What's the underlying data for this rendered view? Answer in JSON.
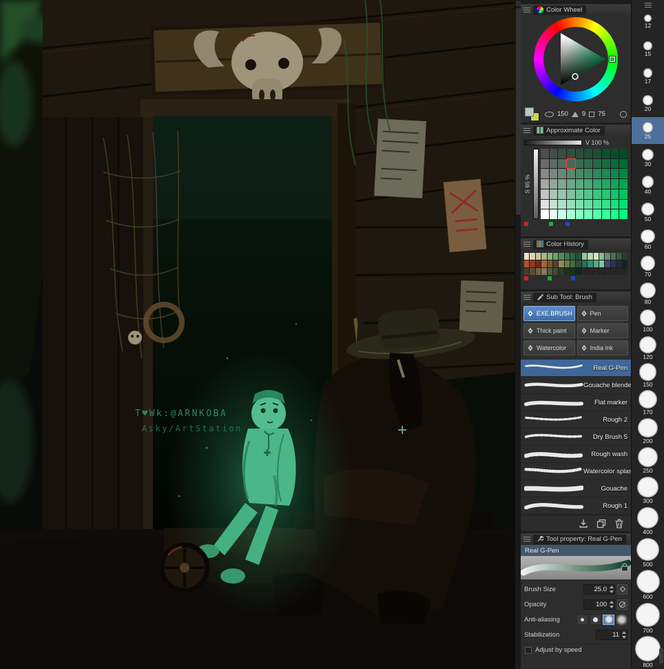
{
  "canvas": {
    "watermark_line1": "T♥Wk:@ARNKOBA",
    "watermark_line2": "Asky/ArtStation"
  },
  "rgb_markers": [
    "#cc2222",
    "#22aa33",
    "#2244cc"
  ],
  "color_wheel": {
    "title": "Color Wheel",
    "hue": "150",
    "sat": "9",
    "val": "75"
  },
  "approximate_color": {
    "title": "Approximate Color",
    "value_label": "V 100 %",
    "sat_label": "S 65 %",
    "grid": {
      "cols": 10,
      "rows": 7,
      "hue": 150,
      "selected_col": 3,
      "selected_row": 1
    }
  },
  "color_history": {
    "title": "Color History",
    "cols": 18,
    "swatches": [
      "#e7e2c6",
      "#d9d3b2",
      "#c7c4a0",
      "#a9b388",
      "#8ab078",
      "#6aa26a",
      "#4f8f5f",
      "#3b7a52",
      "#2d6547",
      "#24543c",
      "#9cc49a",
      "#b7d8ab",
      "#d2e8c0",
      "#8fb691",
      "#63926f",
      "#4a7354",
      "#375741",
      "#263d2d",
      "#b05231",
      "#8e3a24",
      "#6e2d1c",
      "#a06a3c",
      "#7c5430",
      "#5c3f26",
      "#8d8d5b",
      "#6d7c4c",
      "#4c6c41",
      "#315136",
      "#2b6c5c",
      "#3c8c71",
      "#55aa88",
      "#79c6a2",
      "#40486a",
      "#2b3552",
      "#1f2a3c",
      "#16202c",
      "#4c3c2a",
      "#614c32",
      "#766246",
      "#8c785c",
      "#515c41",
      "#3c4c32",
      "#2c3c28",
      "#213020",
      "#18321f",
      "#10261b",
      "",
      "",
      "",
      "",
      "",
      "",
      "",
      ""
    ]
  },
  "sub_tool": {
    "title": "Sub Tool: Brush",
    "tabs": [
      {
        "label": "EXE.BRUSH",
        "selected": true
      },
      {
        "label": "Pen",
        "selected": false
      },
      {
        "label": "Thick paint",
        "selected": false
      },
      {
        "label": "Marker",
        "selected": false
      },
      {
        "label": "Watercolor",
        "selected": false
      },
      {
        "label": "India ink",
        "selected": false
      }
    ],
    "brushes": [
      {
        "name": "Real G-Pen",
        "selected": true
      },
      {
        "name": "Gouache blender",
        "selected": false
      },
      {
        "name": "Flat marker",
        "selected": false
      },
      {
        "name": "Rough 2",
        "selected": false
      },
      {
        "name": "Dry Brush 5",
        "selected": false
      },
      {
        "name": "Rough wash",
        "selected": false
      },
      {
        "name": "Watercolor splash",
        "selected": false
      },
      {
        "name": "Gouache",
        "selected": false
      },
      {
        "name": "Rough 1",
        "selected": false
      }
    ]
  },
  "tool_property": {
    "title": "Tool property: Real G-Pen",
    "brush_name": "Real G-Pen",
    "rows": [
      {
        "label": "Brush Size",
        "value": "25.0",
        "type": "spinner",
        "extra": "dynamics"
      },
      {
        "label": "Opacity",
        "value": "100",
        "type": "spinner",
        "extra": "nodyn"
      },
      {
        "label": "Anti-aliasing",
        "type": "aa",
        "selected_index": 2
      },
      {
        "label": "Stabilization",
        "value": "11",
        "type": "spinner"
      }
    ],
    "checkbox_label": "Adjust by speed",
    "checkbox_checked": false
  },
  "size_palette": {
    "sizes": [
      "12",
      "15",
      "17",
      "20",
      "25",
      "30",
      "40",
      "50",
      "60",
      "70",
      "80",
      "100",
      "120",
      "150",
      "170",
      "200",
      "250",
      "300",
      "400",
      "500",
      "600",
      "700",
      "800"
    ],
    "selected": "25"
  }
}
